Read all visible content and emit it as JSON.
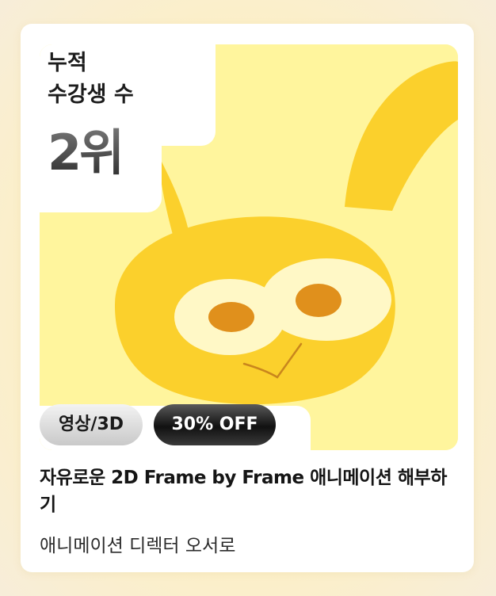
{
  "rank": {
    "label": "누적\n수강생 수",
    "value": "2위"
  },
  "badges": {
    "category": "영상/3D",
    "discount": "30% OFF"
  },
  "course": {
    "title": "자유로운 2D Frame by Frame 애니메이션 해부하기",
    "author": "애니메이션 디렉터 오서로"
  },
  "colors": {
    "thumbnail_background": "#fff59d",
    "character_yellow": "#fbd02c",
    "eye_pupil": "#e0901c"
  },
  "thumbnail": {
    "subject": "yellow-rabbit-character"
  }
}
